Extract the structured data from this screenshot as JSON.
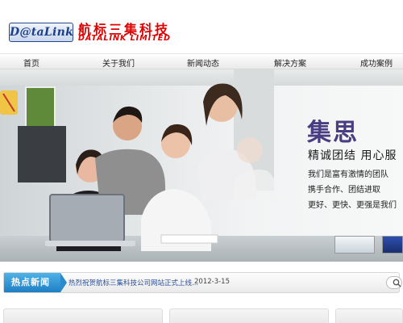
{
  "header": {
    "logo_text": "D@taLink",
    "company_cn": "航标三集科技",
    "company_en": "DATALINK LIMITED"
  },
  "nav": {
    "items": [
      {
        "label": "首页"
      },
      {
        "label": "关于我们"
      },
      {
        "label": "新闻动态"
      },
      {
        "label": "解决方案"
      },
      {
        "label": "成功案例"
      }
    ]
  },
  "banner": {
    "title": "集思",
    "subtitle": "精诚团结 用心服",
    "lines": [
      "我们是富有激情的团队",
      "携手合作、团结进取",
      "更好、更快、更强是我们"
    ]
  },
  "news": {
    "tag": "热点新闻",
    "headline": "热烈祝贺航标三集科技公司网站正式上线...",
    "date": "2012-3-15"
  },
  "colors": {
    "brand_red": "#e00000",
    "logo_blue": "#1c3f8c",
    "slogan_purple": "#4a3e82",
    "news_tag_blue": "#1f7fc4"
  },
  "icons": {
    "search": "search-icon"
  }
}
